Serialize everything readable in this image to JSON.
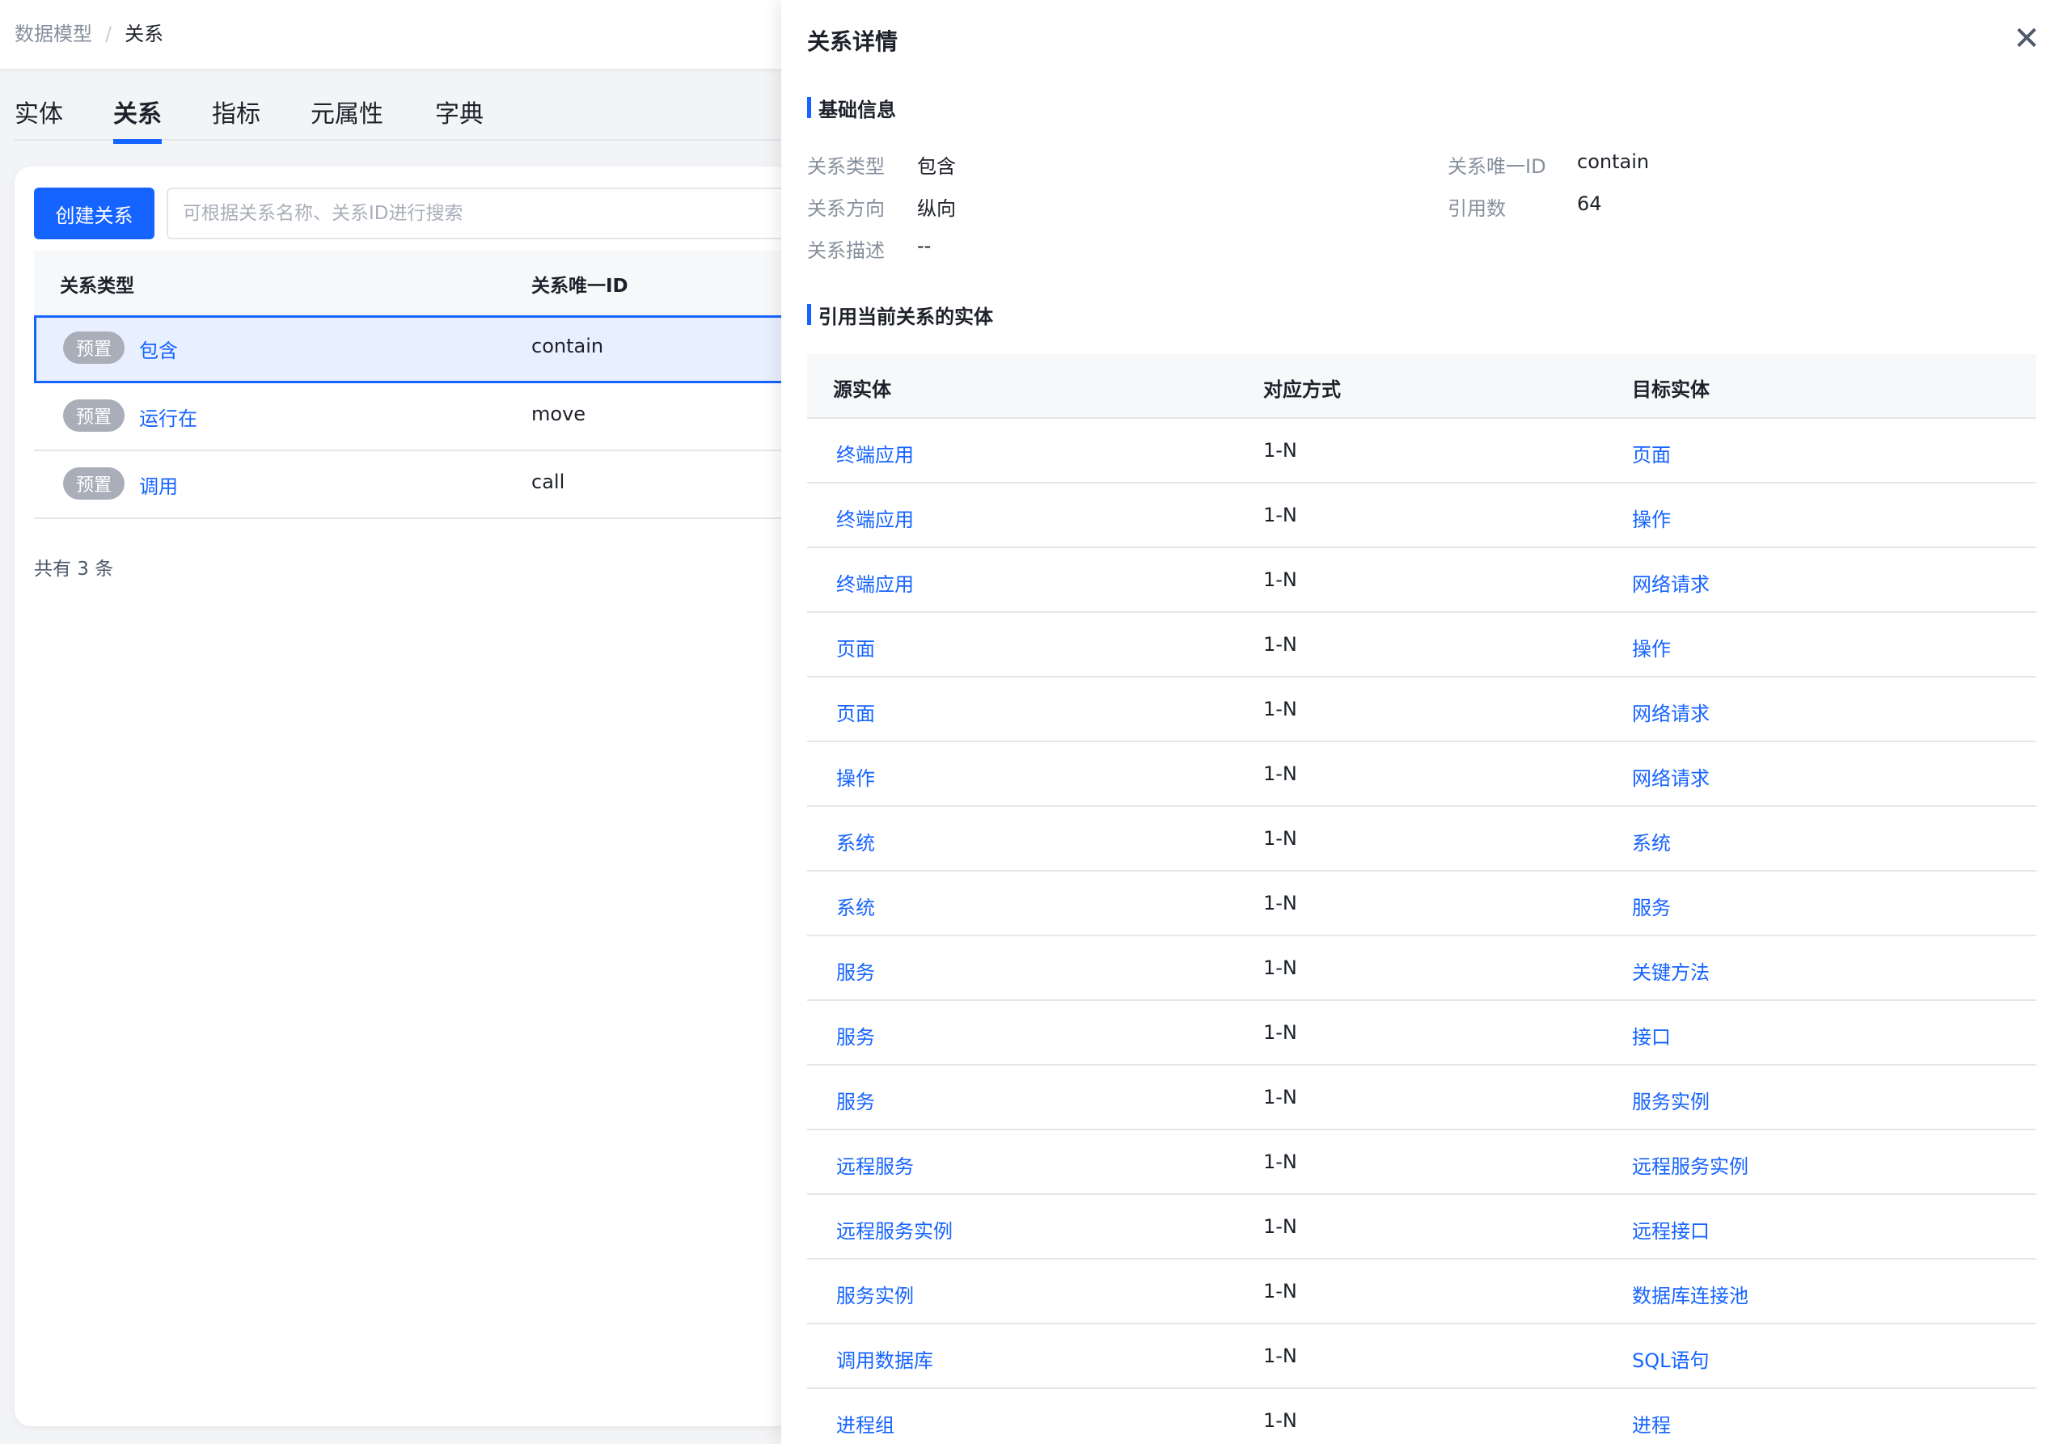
{
  "breadcrumb": {
    "root": "数据模型",
    "separator": "/",
    "current": "关系"
  },
  "tabs": [
    {
      "label": "实体",
      "active": false
    },
    {
      "label": "关系",
      "active": true
    },
    {
      "label": "指标",
      "active": false
    },
    {
      "label": "元属性",
      "active": false
    },
    {
      "label": "字典",
      "active": false
    }
  ],
  "toolbar": {
    "create_label": "创建关系",
    "search_placeholder": "可根据关系名称、关系ID进行搜索"
  },
  "list": {
    "headers": {
      "type": "关系类型",
      "id": "关系唯一ID"
    },
    "rows": [
      {
        "tag": "预置",
        "name": "包含",
        "id": "contain",
        "selected": true
      },
      {
        "tag": "预置",
        "name": "运行在",
        "id": "move",
        "selected": false
      },
      {
        "tag": "预置",
        "name": "调用",
        "id": "call",
        "selected": false
      }
    ],
    "total_text": "共有 3 条"
  },
  "drawer": {
    "title": "关系详情",
    "close_icon": "close-icon",
    "basic_title": "基础信息",
    "basic": {
      "type_label": "关系类型",
      "type_value": "包含",
      "uid_label": "关系唯一ID",
      "uid_value": "contain",
      "direction_label": "关系方向",
      "direction_value": "纵向",
      "refs_label": "引用数",
      "refs_value": "64",
      "desc_label": "关系描述",
      "desc_value": "--"
    },
    "refs_title": "引用当前关系的实体",
    "table": {
      "headers": {
        "source": "源实体",
        "mapping": "对应方式",
        "target": "目标实体"
      },
      "rows": [
        {
          "source": "终端应用",
          "mapping": "1-N",
          "target": "页面"
        },
        {
          "source": "终端应用",
          "mapping": "1-N",
          "target": "操作"
        },
        {
          "source": "终端应用",
          "mapping": "1-N",
          "target": "网络请求"
        },
        {
          "source": "页面",
          "mapping": "1-N",
          "target": "操作"
        },
        {
          "source": "页面",
          "mapping": "1-N",
          "target": "网络请求"
        },
        {
          "source": "操作",
          "mapping": "1-N",
          "target": "网络请求"
        },
        {
          "source": "系统",
          "mapping": "1-N",
          "target": "系统"
        },
        {
          "source": "系统",
          "mapping": "1-N",
          "target": "服务"
        },
        {
          "source": "服务",
          "mapping": "1-N",
          "target": "关键方法"
        },
        {
          "source": "服务",
          "mapping": "1-N",
          "target": "接口"
        },
        {
          "source": "服务",
          "mapping": "1-N",
          "target": "服务实例"
        },
        {
          "source": "远程服务",
          "mapping": "1-N",
          "target": "远程服务实例"
        },
        {
          "source": "远程服务实例",
          "mapping": "1-N",
          "target": "远程接口"
        },
        {
          "source": "服务实例",
          "mapping": "1-N",
          "target": "数据库连接池"
        },
        {
          "source": "调用数据库",
          "mapping": "1-N",
          "target": "SQL语句"
        },
        {
          "source": "进程组",
          "mapping": "1-N",
          "target": "进程"
        }
      ]
    }
  },
  "colors": {
    "accent": "#1664ff",
    "tag_bg": "#a9aeb8",
    "selected_row_bg": "#e8f0ff"
  }
}
